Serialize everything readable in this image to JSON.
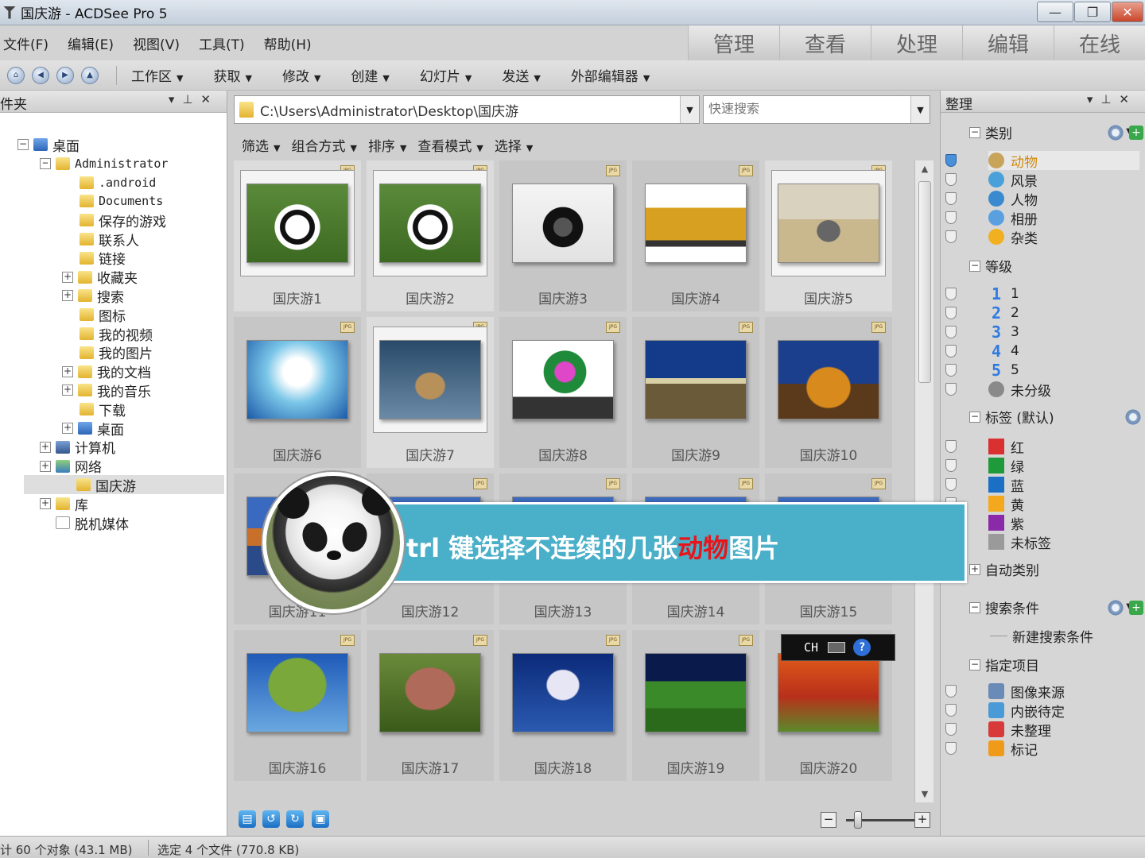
{
  "window": {
    "title": "国庆游 - ACDSee Pro 5",
    "minimize": "—",
    "maximize": "❐",
    "close": "✕"
  },
  "menus": [
    "文件(F)",
    "编辑(E)",
    "视图(V)",
    "工具(T)",
    "帮助(H)"
  ],
  "mode_tabs": [
    "管理",
    "查看",
    "处理",
    "编辑",
    "在线"
  ],
  "toolbar": {
    "items": [
      "工作区",
      "获取",
      "修改",
      "创建",
      "幻灯片",
      "发送",
      "外部编辑器"
    ]
  },
  "folder_panel": {
    "title": "件夹",
    "tree": [
      {
        "label": "桌面",
        "expander": "−",
        "icon": "desk"
      },
      {
        "label": "Administrator",
        "expander": "−",
        "icon": "user",
        "mono": true
      },
      {
        "label": ".android",
        "icon": "folder",
        "mono": true
      },
      {
        "label": "Documents",
        "icon": "folder",
        "mono": true
      },
      {
        "label": "保存的游戏",
        "icon": "folder"
      },
      {
        "label": "联系人",
        "icon": "folder"
      },
      {
        "label": "链接",
        "icon": "folder"
      },
      {
        "label": "收藏夹",
        "expander": "+",
        "icon": "folder"
      },
      {
        "label": "搜索",
        "expander": "+",
        "icon": "folder"
      },
      {
        "label": "图标",
        "icon": "folder"
      },
      {
        "label": "我的视频",
        "icon": "folder"
      },
      {
        "label": "我的图片",
        "icon": "folder"
      },
      {
        "label": "我的文档",
        "expander": "+",
        "icon": "folder"
      },
      {
        "label": "我的音乐",
        "expander": "+",
        "icon": "folder"
      },
      {
        "label": "下载",
        "icon": "folder"
      },
      {
        "label": "桌面",
        "expander": "+",
        "icon": "desk"
      },
      {
        "label": "计算机",
        "expander": "+",
        "icon": "comp"
      },
      {
        "label": "网络",
        "expander": "+",
        "icon": "net"
      },
      {
        "label": "国庆游",
        "icon": "folder",
        "selected": true
      },
      {
        "label": "库",
        "expander": "+",
        "icon": "folder"
      },
      {
        "label": "脱机媒体",
        "icon": "doc"
      }
    ]
  },
  "browser": {
    "path": "C:\\Users\\Administrator\\Desktop\\国庆游",
    "search_placeholder": "快速搜索",
    "filters": [
      "筛选",
      "组合方式",
      "排序",
      "查看模式",
      "选择"
    ],
    "jpg_badge": "JPG",
    "thumbnails": [
      {
        "label": "国庆游1",
        "selected": true,
        "subject": "panda"
      },
      {
        "label": "国庆游2",
        "selected": true,
        "subject": "panda"
      },
      {
        "label": "国庆游3",
        "selected": false,
        "subject": "camera"
      },
      {
        "label": "国庆游4",
        "selected": false,
        "subject": "bus"
      },
      {
        "label": "国庆游5",
        "selected": true,
        "subject": "rhino"
      },
      {
        "label": "国庆游6",
        "selected": false,
        "subject": "glassware"
      },
      {
        "label": "国庆游7",
        "selected": true,
        "subject": "wolf"
      },
      {
        "label": "国庆游8",
        "selected": false,
        "subject": "laptop"
      },
      {
        "label": "国庆游9",
        "selected": false,
        "subject": "birch-trees"
      },
      {
        "label": "国庆游10",
        "selected": false,
        "subject": "autumn-trees"
      },
      {
        "label": "国庆游11",
        "selected": false,
        "subject": "lake"
      },
      {
        "label": "国庆游12",
        "selected": false,
        "subject": "landscape"
      },
      {
        "label": "国庆游13",
        "selected": false,
        "subject": "landscape"
      },
      {
        "label": "国庆游14",
        "selected": false,
        "subject": "landscape"
      },
      {
        "label": "国庆游15",
        "selected": false,
        "subject": "landscape"
      },
      {
        "label": "国庆游16",
        "selected": false,
        "subject": "willow"
      },
      {
        "label": "国庆游17",
        "selected": false,
        "subject": "red-tree"
      },
      {
        "label": "国庆游18",
        "selected": false,
        "subject": "blossom-tree"
      },
      {
        "label": "国庆游19",
        "selected": false,
        "subject": "meadow"
      },
      {
        "label": "国庆游20",
        "selected": false,
        "subject": "autumn-forest"
      }
    ],
    "zoom_out": "−",
    "zoom_in": "+"
  },
  "organize_panel": {
    "title": "整理",
    "categories": {
      "title": "类别",
      "items": [
        "动物",
        "风景",
        "人物",
        "相册",
        "杂类"
      ],
      "active": "动物"
    },
    "ratings": {
      "title": "等级",
      "items": [
        "1",
        "2",
        "3",
        "4",
        "5"
      ],
      "unrated": "未分级"
    },
    "labels": {
      "title": "标签 (默认)",
      "items": [
        {
          "name": "红",
          "color": "#d93030"
        },
        {
          "name": "绿",
          "color": "#1f9a3a"
        },
        {
          "name": "蓝",
          "color": "#1b6fc4"
        },
        {
          "name": "黄",
          "color": "#f3a81e"
        },
        {
          "name": "紫",
          "color": "#8b2aa8"
        },
        {
          "name": "未标签",
          "color": "#9a9a9a"
        }
      ]
    },
    "auto_categories": {
      "title": "自动类别"
    },
    "search_criteria": {
      "title": "搜索条件",
      "new": "新建搜索条件"
    },
    "special_items": {
      "title": "指定项目",
      "items": [
        "图像来源",
        "内嵌待定",
        "未整理",
        "标记"
      ]
    }
  },
  "statusbar": {
    "total": "计 60 个对象 (43.1 MB)",
    "selected": "选定 4 个文件 (770.8 KB)"
  },
  "overlay": {
    "pre": "trl 键选择不连续的几张",
    "highlight": "动物",
    "post": "图片",
    "highlight_color": "#e8141a"
  },
  "ime": {
    "label": "CH",
    "help": "?"
  }
}
